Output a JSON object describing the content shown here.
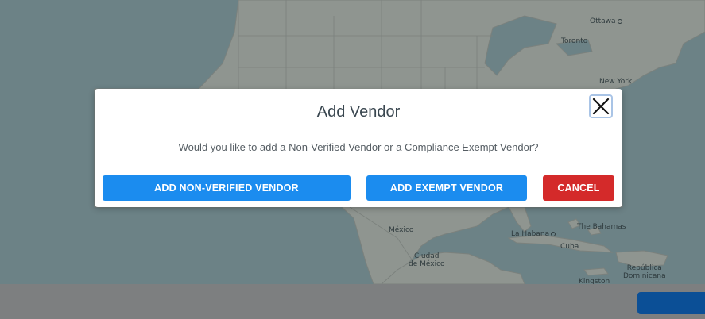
{
  "map": {
    "labels": {
      "ottawa": "Ottawa",
      "toronto": "Toronto",
      "new_york": "New York",
      "mexico": "México",
      "ciudad_de_mexico": "Ciudad\nde México",
      "la_habana": "La Habana",
      "bahamas": "The Bahamas",
      "cuba": "Cuba",
      "republica_dominicana": "República\nDominicana",
      "kingston": "Kingston"
    },
    "colors": {
      "water": "#6c8286",
      "land": "#8f9590"
    }
  },
  "modal": {
    "title": "Add Vendor",
    "message": "Would you like to add a Non-Verified Vendor or a Compliance Exempt Vendor?",
    "buttons": {
      "non_verified": "ADD NON-VERIFIED VENDOR",
      "exempt": "ADD EXEMPT VENDOR",
      "cancel": "CANCEL"
    },
    "colors": {
      "primary": "#1b8cef",
      "danger": "#d42a2a"
    }
  }
}
